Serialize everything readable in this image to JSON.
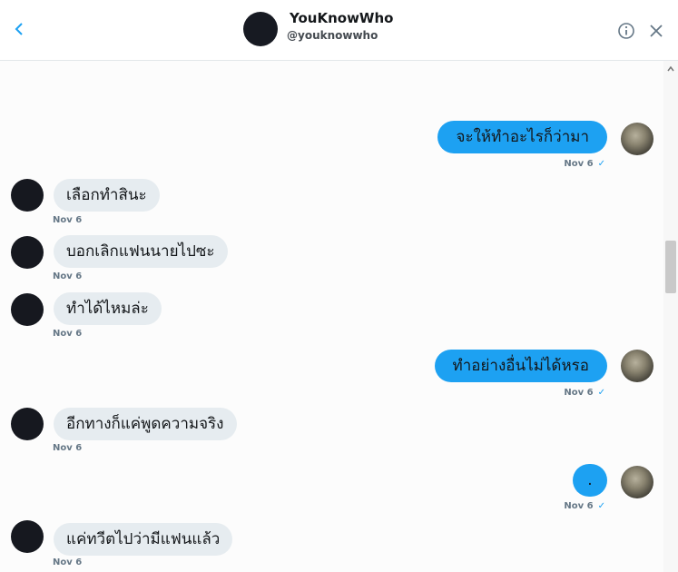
{
  "header": {
    "name": "YouKnowWho",
    "handle": "@youknowwho"
  },
  "messages": [
    {
      "dir": "out",
      "text": "จะให้ทำอะไรก็ว่ามา",
      "time": "Nov 6"
    },
    {
      "dir": "in",
      "text": "เลือกทำสินะ",
      "time": "Nov 6"
    },
    {
      "dir": "in",
      "text": "บอกเลิกแฟนนายไปซะ",
      "time": "Nov 6"
    },
    {
      "dir": "in",
      "text": "ทำได้ไหมล่ะ",
      "time": "Nov 6"
    },
    {
      "dir": "out",
      "text": "ทำอย่างอื่นไม่ได้หรอ",
      "time": "Nov 6"
    },
    {
      "dir": "in",
      "text": "อีกทางก็แค่พูดความจริง",
      "time": "Nov 6"
    },
    {
      "dir": "out",
      "text": ".",
      "time": "Nov 6"
    },
    {
      "dir": "in",
      "text": "แค่ทวีตไปว่ามีแฟนแล้ว",
      "time": "Nov 6"
    }
  ],
  "receipt_mark": "✓",
  "colors": {
    "accent": "#1da1f2",
    "incoming_bubble": "#e6ecf0",
    "timestamp": "#657786"
  },
  "icons": [
    "back-chevron-icon",
    "info-icon",
    "close-icon"
  ]
}
